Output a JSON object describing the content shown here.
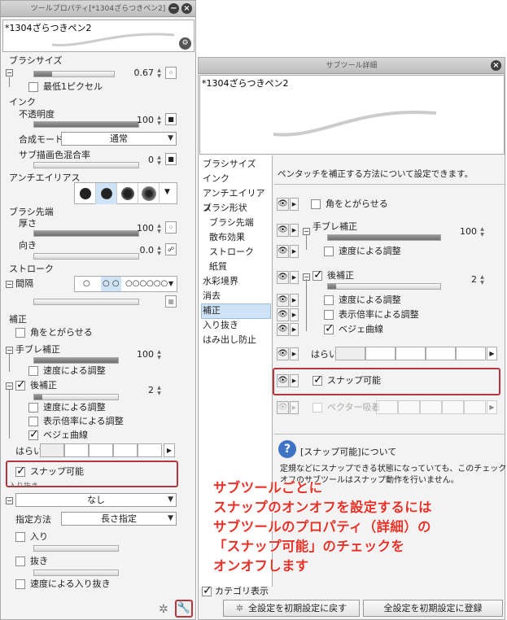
{
  "left_panel": {
    "title": "ツールプロパティ[*1304ざらつきペン2]",
    "close": "−",
    "close2": "×",
    "brush_name": "*1304ざらつきペン2",
    "brush_size": {
      "label": "ブラシサイズ",
      "value": "0.67"
    },
    "min_1px": "最低1ピクセル",
    "ink": "インク",
    "opacity": {
      "label": "不透明度",
      "value": "100"
    },
    "blend_mode": {
      "label": "合成モード",
      "value": "通常"
    },
    "sub_color": {
      "label": "サブ描画色混合率",
      "value": "0"
    },
    "antialias": "アンチエイリアス",
    "brush_tip": "ブラシ先端",
    "thickness": {
      "label": "厚さ",
      "value": "100"
    },
    "direction": {
      "label": "向き",
      "value": "0.0"
    },
    "stroke": "ストローク",
    "interval": "間隔",
    "correction": "補正",
    "sharpen_corners": "角をとがらせる",
    "stabilize": {
      "label": "手ブレ補正",
      "value": "100"
    },
    "speed_adjust": "速度による調整",
    "post_correction": {
      "label": "後補正",
      "value": "2"
    },
    "speed_adjust2": "速度による調整",
    "zoom_adjust": "表示倍率による調整",
    "bezier": "ベジェ曲線",
    "harai": "はらい",
    "snap": "スナップ可能",
    "fade": "入り抜き",
    "fade_value": "なし",
    "spec_method": {
      "label": "指定方法",
      "value": "長さ指定"
    },
    "fade_in": "入り",
    "fade_out": "抜き",
    "speed_fade": "速度による入り抜き"
  },
  "right_panel": {
    "title": "サブツール詳細",
    "close": "×",
    "brush_name": "*1304ざらつきペン2",
    "categories": [
      "ブラシサイズ",
      "インク",
      "アンチエイリアス",
      "ブラシ形状",
      "ブラシ先端",
      "散布効果",
      "ストローク",
      "紙質",
      "水彩境界",
      "消去",
      "補正",
      "入り抜き",
      "はみ出し防止"
    ],
    "selected_category": "補正",
    "description": "ペンタッチを補正する方法について設定できます。",
    "sharpen_corners": "角をとがらせる",
    "stabilize": {
      "label": "手ブレ補正",
      "value": "100"
    },
    "speed_adjust": "速度による調整",
    "post_correction": {
      "label": "後補正",
      "value": "2"
    },
    "speed_adjust2": "速度による調整",
    "zoom_adjust": "表示倍率による調整",
    "bezier": "ベジェ曲線",
    "harai": "はらい",
    "snap": "スナップ可能",
    "vector_snap": "ベクター吸着",
    "help_title": "[スナップ可能]について",
    "help_text1": "定規などにスナップできる状態になっていても、このチェックが",
    "help_text2": "オフのサブツールはスナップ動作を行いません。",
    "category_display": "カテゴリ表示",
    "reset_button": "全設定を初期設定に戻す",
    "register_button": "全設定を初期設定に登録"
  },
  "caption": {
    "line1": "サブツールごとに",
    "line2": "スナップのオンオフを設定するには",
    "line3": "サブツールのプロパティ（詳細）の",
    "line4": "「スナップ可能」のチェックを",
    "line5": "オンオフします"
  },
  "colors": {
    "highlight": "#b5363d",
    "caption": "#e83228"
  }
}
